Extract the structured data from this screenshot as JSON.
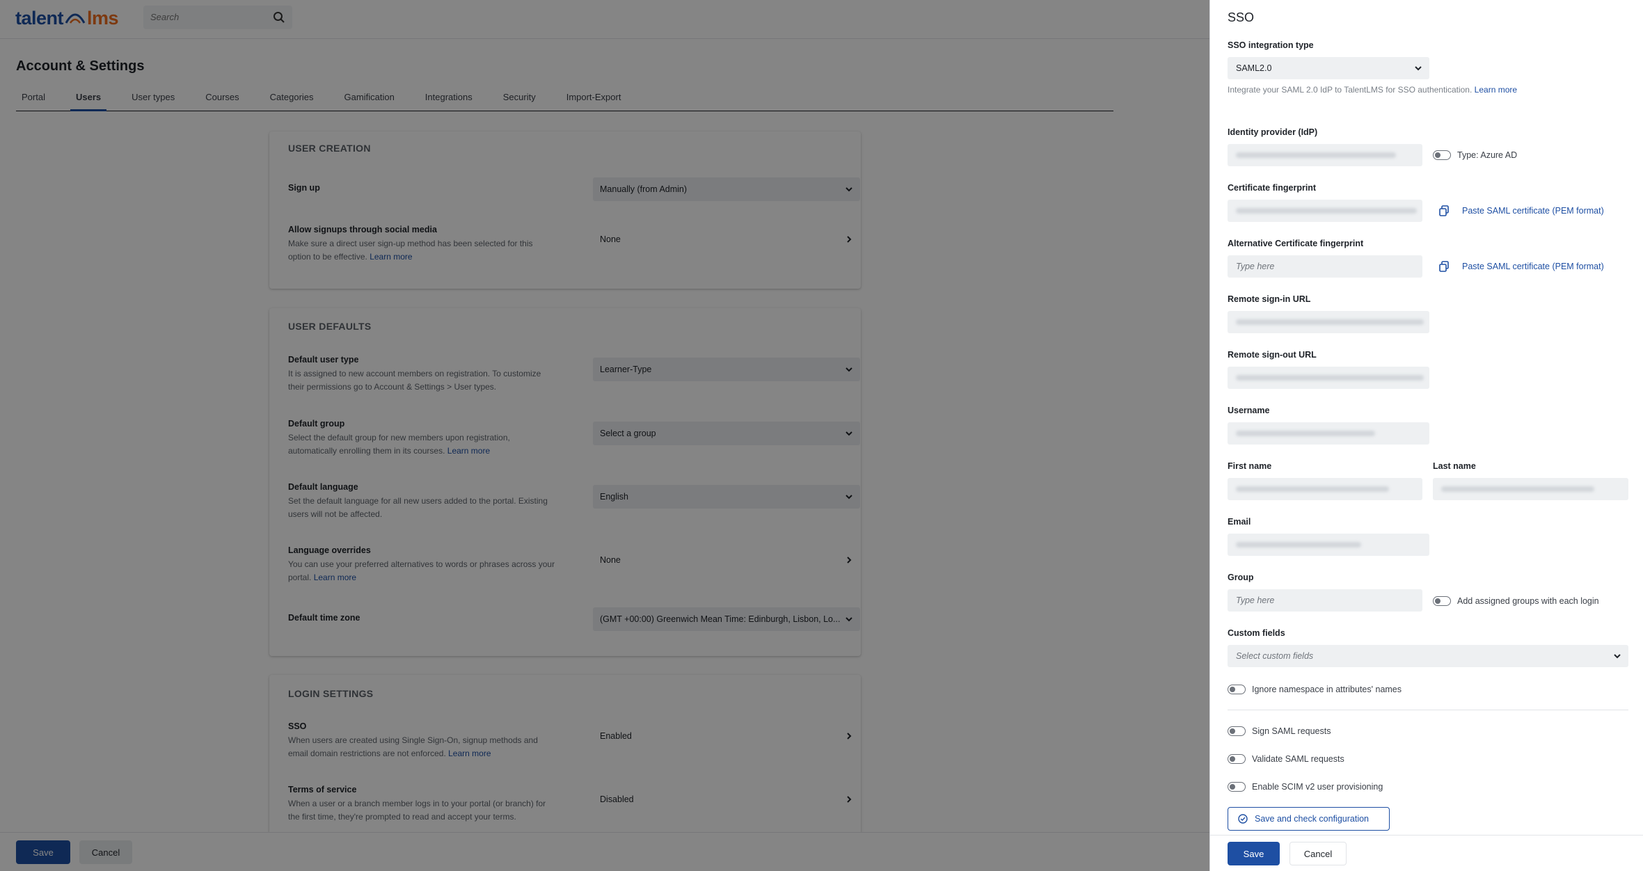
{
  "header": {
    "logo_left": "talent",
    "logo_right": "lms",
    "search_placeholder": "Search"
  },
  "page": {
    "title": "Account & Settings",
    "tabs": [
      {
        "label": "Portal"
      },
      {
        "label": "Users",
        "active": true
      },
      {
        "label": "User types"
      },
      {
        "label": "Courses"
      },
      {
        "label": "Categories"
      },
      {
        "label": "Gamification"
      },
      {
        "label": "Integrations"
      },
      {
        "label": "Security"
      },
      {
        "label": "Import-Export"
      }
    ]
  },
  "user_creation": {
    "heading": "USER CREATION",
    "signup": {
      "label": "Sign up",
      "value": "Manually (from Admin)"
    },
    "social": {
      "label": "Allow signups through social media",
      "desc": "Make sure a direct user sign-up method has been selected for this option to be effective.",
      "link": "Learn more",
      "value": "None"
    }
  },
  "user_defaults": {
    "heading": "USER DEFAULTS",
    "user_type": {
      "label": "Default user type",
      "desc": "It is assigned to new account members on registration. To customize their permissions go to Account & Settings > User types.",
      "value": "Learner-Type"
    },
    "group": {
      "label": "Default group",
      "desc": "Select the default group for new members upon registration, automatically enrolling them in its courses.",
      "link": "Learn more",
      "value": "Select a group"
    },
    "language": {
      "label": "Default language",
      "desc": "Set the default language for all new users added to the portal. Existing users will not be affected.",
      "value": "English"
    },
    "overrides": {
      "label": "Language overrides",
      "desc": "You can use your preferred alternatives to words or phrases across your portal.",
      "link": "Learn more",
      "value": "None"
    },
    "timezone": {
      "label": "Default time zone",
      "value": "(GMT +00:00) Greenwich Mean Time: Edinburgh, Lisbon, Lo..."
    }
  },
  "login_settings": {
    "heading": "LOGIN SETTINGS",
    "sso": {
      "label": "SSO",
      "desc": "When users are created using Single Sign-On, signup methods and email domain restrictions are not enforced.",
      "link": "Learn more",
      "value": "Enabled"
    },
    "tos": {
      "label": "Terms of service",
      "desc": "When a user or a branch member logs in to your portal (or branch) for the first time, they're prompted to read and accept your terms.",
      "value": "Disabled"
    }
  },
  "footer": {
    "save": "Save",
    "cancel": "Cancel"
  },
  "sso_panel": {
    "title": "SSO",
    "integration_type_label": "SSO integration type",
    "integration_type_value": "SAML2.0",
    "integration_hint": "Integrate your SAML 2.0 IdP to TalentLMS for SSO authentication.",
    "integration_link": "Learn more",
    "idp_label": "Identity provider (IdP)",
    "azure_toggle_label": "Type: Azure AD",
    "cert_label": "Certificate fingerprint",
    "paste_cert": "Paste SAML certificate (PEM format)",
    "alt_cert_label": "Alternative Certificate fingerprint",
    "alt_cert_placeholder": "Type here",
    "paste_cert_alt": "Paste SAML certificate (PEM format)",
    "signin_label": "Remote sign-in URL",
    "signout_label": "Remote sign-out URL",
    "username_label": "Username",
    "firstname_label": "First name",
    "lastname_label": "Last name",
    "email_label": "Email",
    "group_label": "Group",
    "group_placeholder": "Type here",
    "group_toggle_label": "Add assigned groups with each login",
    "custom_fields_label": "Custom fields",
    "custom_fields_placeholder": "Select custom fields",
    "namespace_toggle": "Ignore namespace in attributes' names",
    "sign_toggle": "Sign SAML requests",
    "validate_toggle": "Validate SAML requests",
    "scim_toggle": "Enable SCIM v2 user provisioning",
    "save_check": "Save and check configuration",
    "save": "Save",
    "cancel": "Cancel"
  }
}
